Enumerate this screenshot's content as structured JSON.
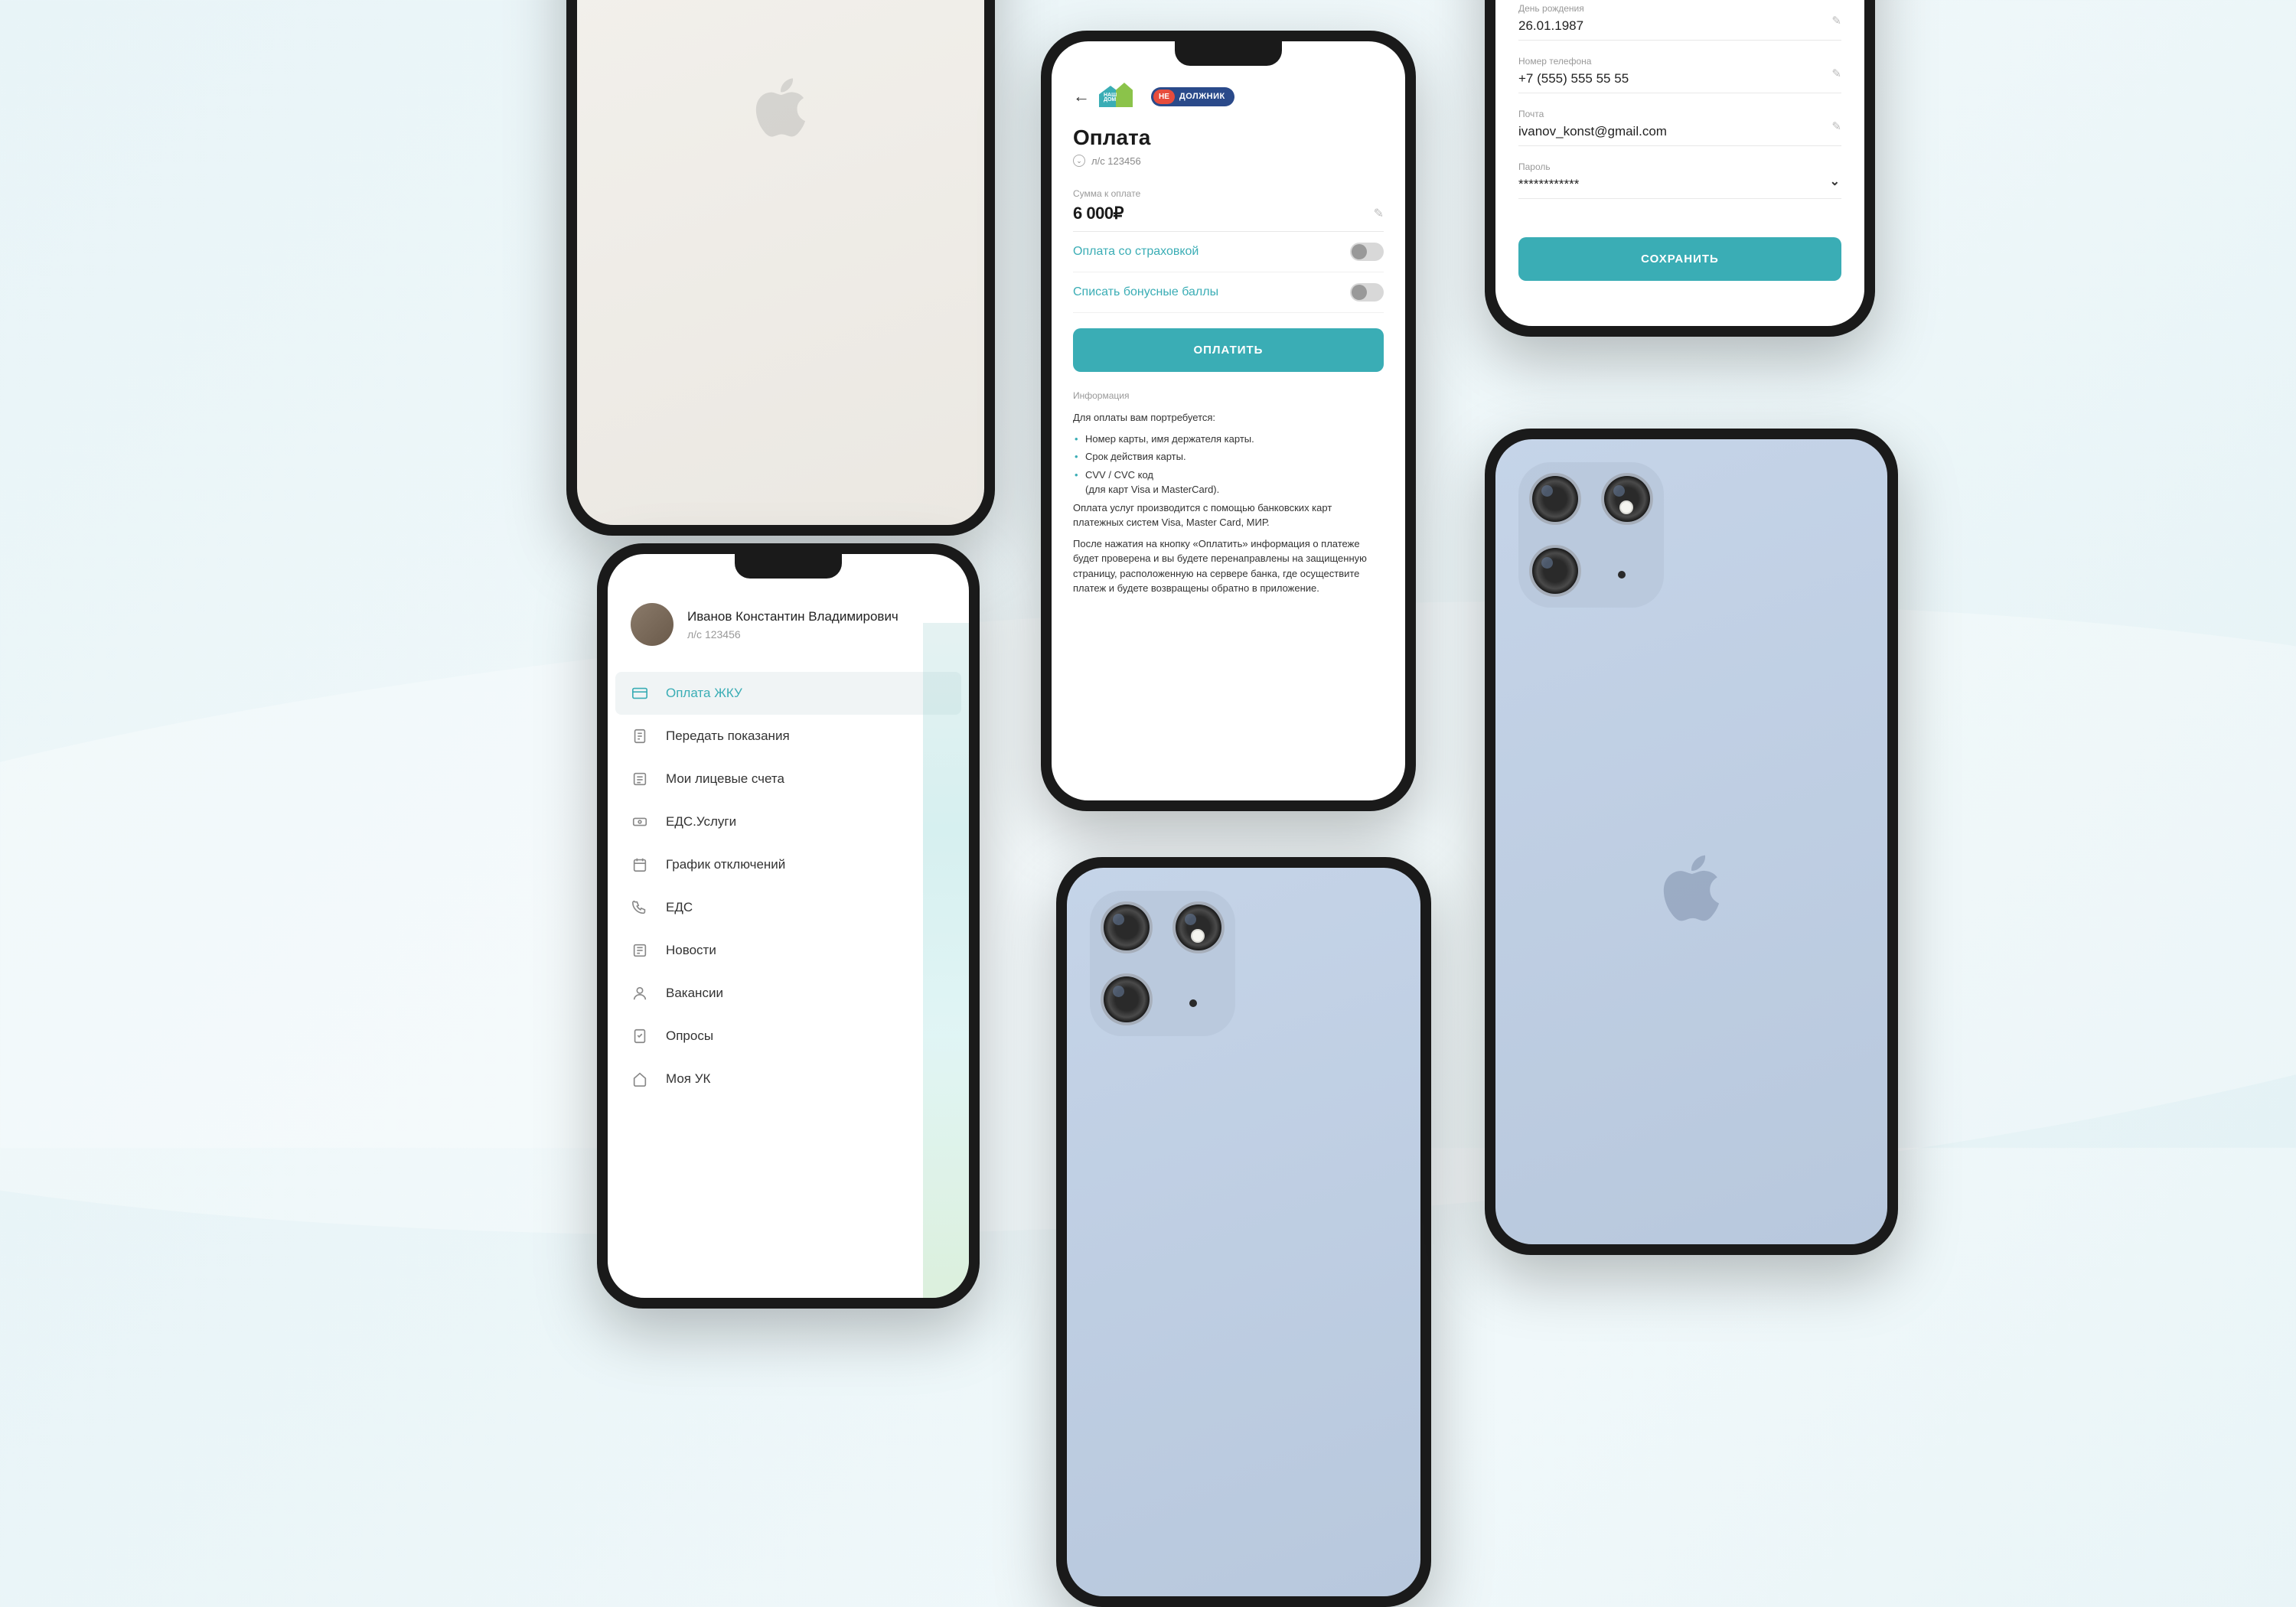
{
  "menu": {
    "profile_name": "Иванов Константин Владимирович",
    "profile_account": "л/с 123456",
    "items": [
      {
        "label": "Оплата ЖКУ"
      },
      {
        "label": "Передать показания"
      },
      {
        "label": "Мои лицевые счета"
      },
      {
        "label": "ЕДС.Услуги"
      },
      {
        "label": "График отключений"
      },
      {
        "label": "ЕДС"
      },
      {
        "label": "Новости"
      },
      {
        "label": "Вакансии"
      },
      {
        "label": "Опросы"
      },
      {
        "label": "Моя УК"
      }
    ]
  },
  "payment": {
    "badge_ne": "НЕ",
    "badge_text": "ДОЛЖНИК",
    "title": "Оплата",
    "account": "л/с 123456",
    "amount_label": "Сумма к оплате",
    "amount": "6 000₽",
    "toggle1": "Оплата со страховкой",
    "toggle2": "Списать бонусные баллы",
    "pay_btn": "ОПЛАТИТЬ",
    "info_title": "Информация",
    "info_intro": "Для оплаты вам портребуется:",
    "info_li1": "Номер карты, имя держателя карты.",
    "info_li2": "Срок действия карты.",
    "info_li3a": "CVV / CVC код",
    "info_li3b": "(для карт Visa и MasterCard).",
    "info_p1": "Оплата услуг производится с помощью банковских карт платежных систем Visa, Master Card, МИР.",
    "info_p2": "После нажатия на кнопку «Оплатить» информация о платеже будет проверена и вы будете перенаправлены на защищенную страницу, расположенную на сервере банка, где осуществите платеж и будете возвращены обратно в приложение."
  },
  "profile": {
    "f1_label": "День рождения",
    "f1_value": "26.01.1987",
    "f2_label": "Номер телефона",
    "f2_value": "+7 (555) 555 55 55",
    "f3_label": "Почта",
    "f3_value": "ivanov_konst@gmail.com",
    "f4_label": "Пароль",
    "f4_value": "************",
    "save_btn": "СОХРАНИТЬ"
  }
}
